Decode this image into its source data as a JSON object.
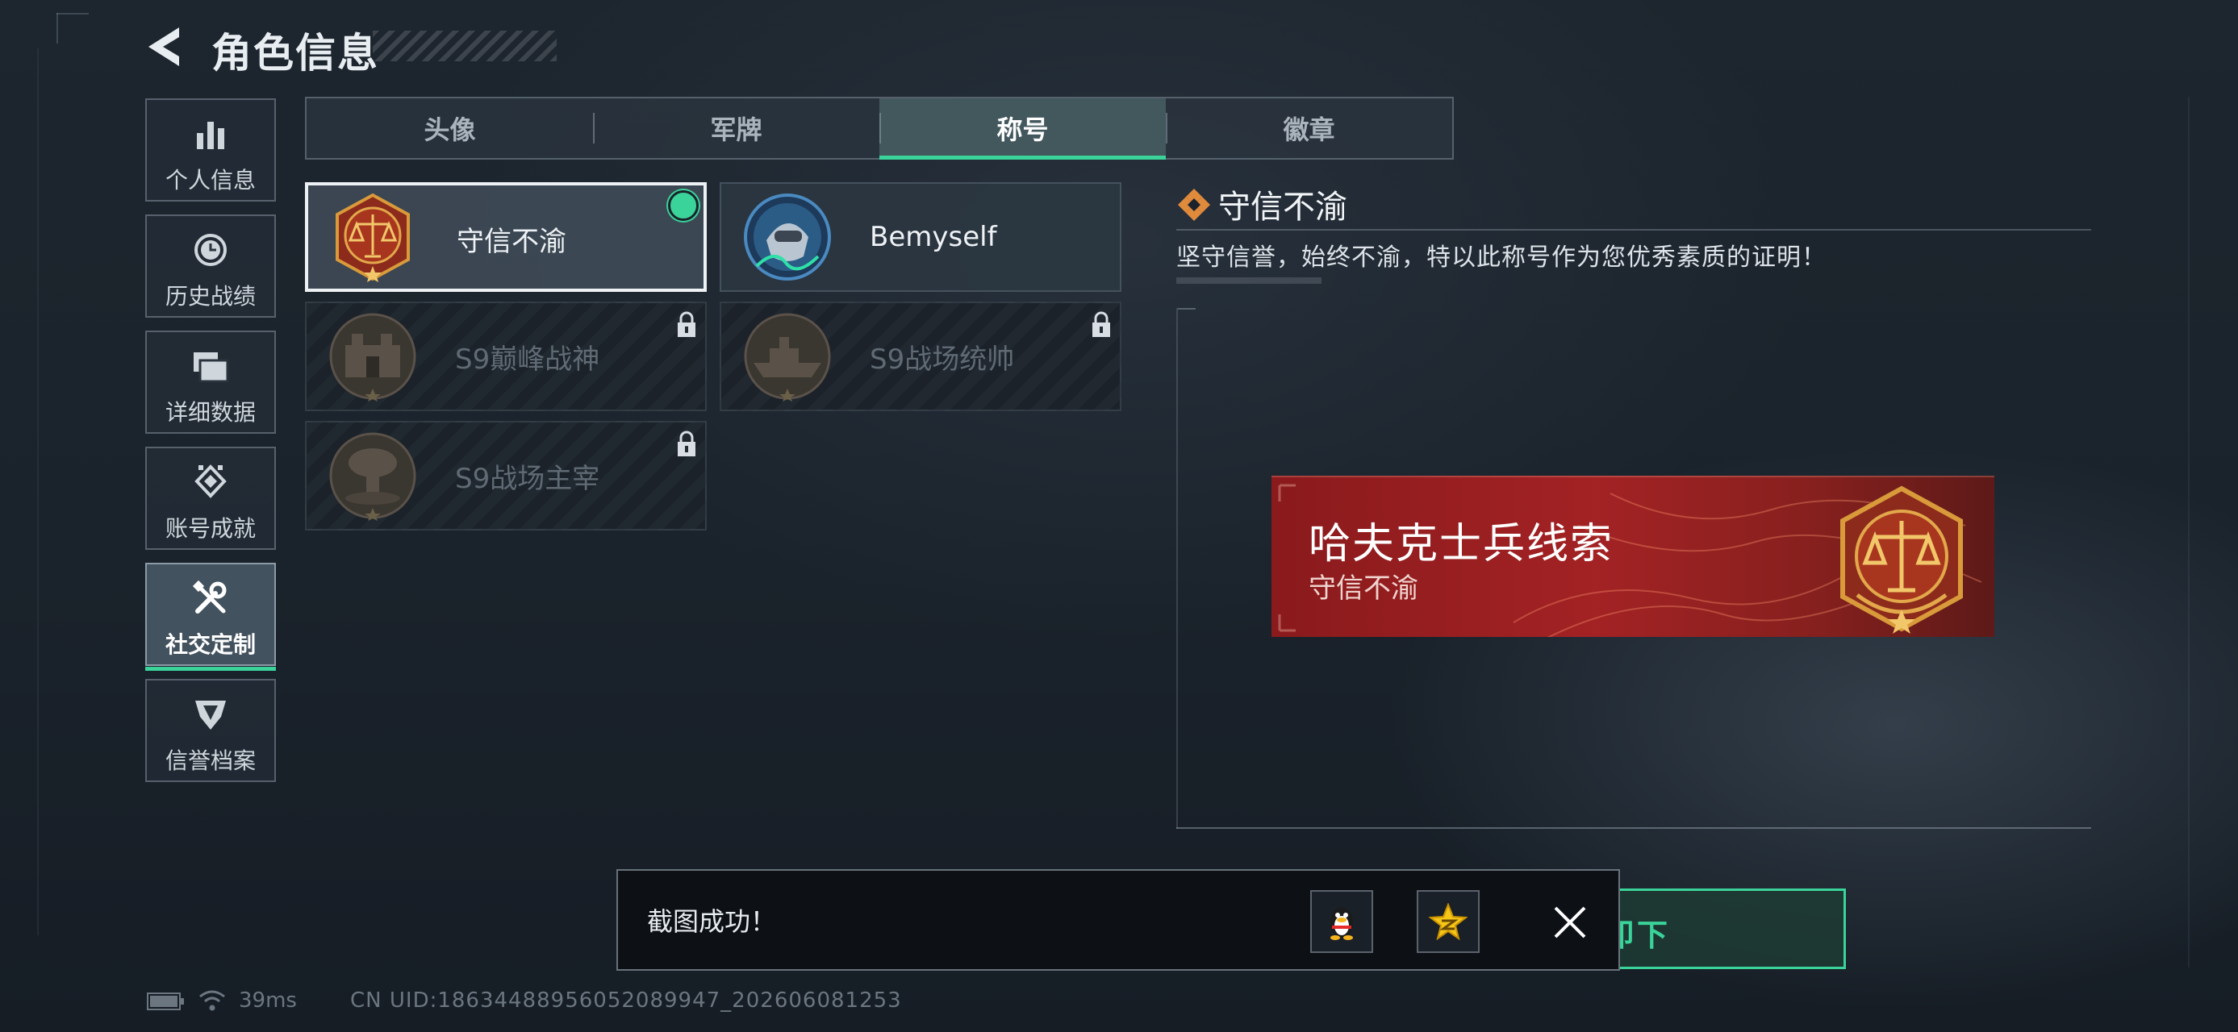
{
  "header": {
    "title": "角色信息",
    "back_icon": "back-arrow-icon"
  },
  "sidebar": {
    "items": [
      {
        "label": "个人信息",
        "icon": "bar-chart-icon",
        "active": false
      },
      {
        "label": "历史战绩",
        "icon": "history-clock-icon",
        "active": false
      },
      {
        "label": "详细数据",
        "icon": "folder-icon",
        "active": false
      },
      {
        "label": "账号成就",
        "icon": "achievement-icon",
        "active": false
      },
      {
        "label": "社交定制",
        "icon": "tools-icon",
        "active": true
      },
      {
        "label": "信誉档案",
        "icon": "credit-shield-icon",
        "active": false
      }
    ]
  },
  "tabs": [
    {
      "label": "头像",
      "active": false
    },
    {
      "label": "军牌",
      "active": false
    },
    {
      "label": "称号",
      "active": true
    },
    {
      "label": "徽章",
      "active": false
    }
  ],
  "titles": [
    {
      "name": "守信不渝",
      "selected": true,
      "equipped": true,
      "locked": false,
      "icon": "scales-badge-icon"
    },
    {
      "name": "Bemyself",
      "selected": false,
      "equipped": false,
      "locked": false,
      "icon": "soldier-signature-badge-icon"
    },
    {
      "name": "S9巅峰战神",
      "selected": false,
      "equipped": false,
      "locked": true,
      "icon": "fortress-badge-icon"
    },
    {
      "name": "S9战场统帅",
      "selected": false,
      "equipped": false,
      "locked": true,
      "icon": "warship-badge-icon"
    },
    {
      "name": "S9战场主宰",
      "selected": false,
      "equipped": false,
      "locked": true,
      "icon": "mushroom-cloud-badge-icon"
    }
  ],
  "detail": {
    "name": "守信不渝",
    "description": "坚守信誉，始终不渝，特以此称号作为您优秀素质的证明！",
    "icon": "diamond-title-icon"
  },
  "preview": {
    "player_name": "哈夫克士兵线索",
    "title": "守信不渝",
    "badge_icon": "scales-badge-icon"
  },
  "unequip_button": {
    "label": "卸下"
  },
  "toast": {
    "message": "截图成功！",
    "share_buttons": [
      {
        "name": "qq-share-button",
        "icon": "qq-penguin-icon"
      },
      {
        "name": "qzone-share-button",
        "icon": "qzone-star-icon"
      }
    ],
    "close_icon": "close-x-icon"
  },
  "status_bar": {
    "battery_icon": "battery-icon",
    "wifi_icon": "wifi-icon",
    "ping": "39ms",
    "uid": "CN UID:18634488956052089947_202606081253"
  },
  "colors": {
    "accent_green": "#3ad39a",
    "banner_red": "#a32224",
    "background": "#1a222b"
  }
}
